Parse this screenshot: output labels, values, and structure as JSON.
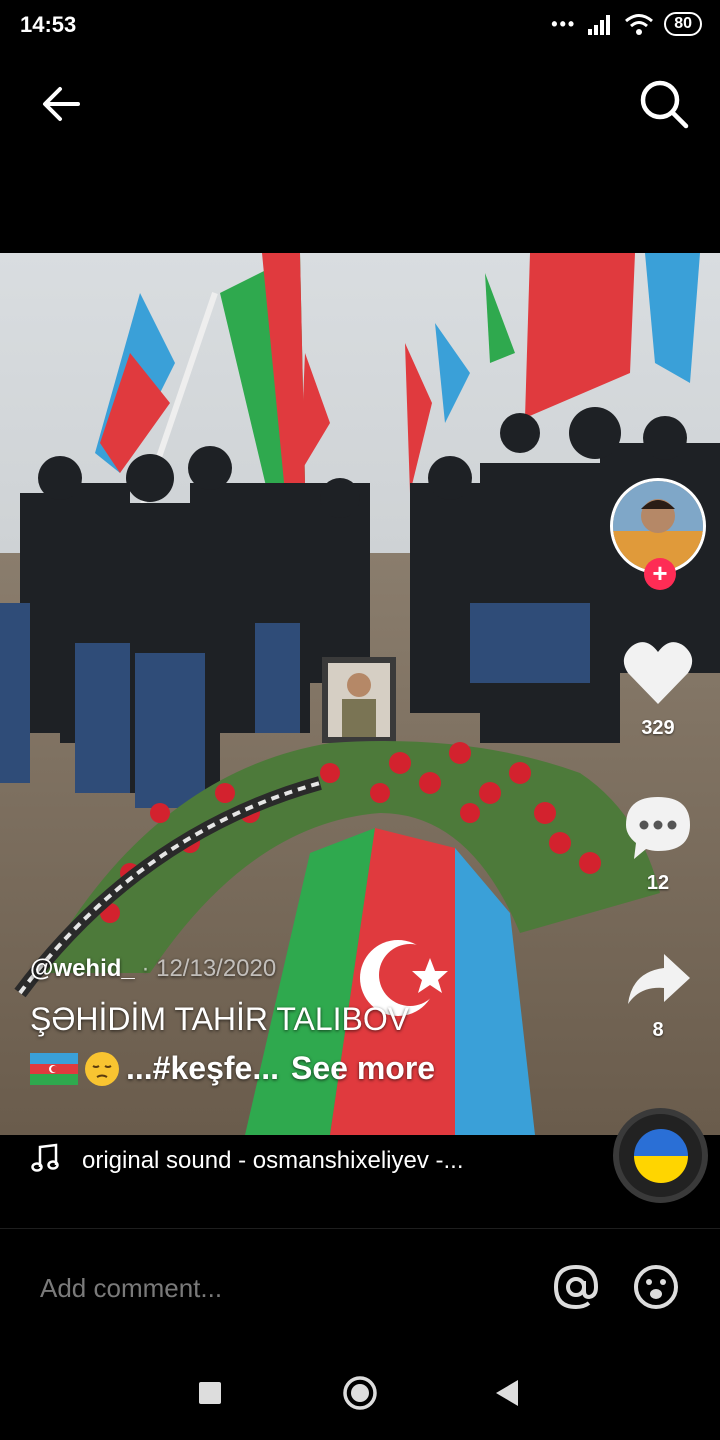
{
  "status": {
    "time": "14:53",
    "battery": "80"
  },
  "author": {
    "handle": "@wehid_",
    "date": "12/13/2020"
  },
  "caption": {
    "title": "ŞƏHİDİM TAHİR TALIBOV",
    "emoji_1": "azerbaijan-flag",
    "emoji_2": "pensive-face",
    "text": "...#keşfe...",
    "see_more": "See more"
  },
  "actions": {
    "likes": "329",
    "comments": "12",
    "shares": "8"
  },
  "music": {
    "label": "original sound - osmanshixeliyev -..."
  },
  "comment_input": {
    "placeholder": "Add comment..."
  },
  "colors": {
    "accent": "#fe2c55",
    "flag_blue": "#3aa0d8",
    "flag_red": "#e03a3e",
    "flag_green": "#2fa94e"
  }
}
